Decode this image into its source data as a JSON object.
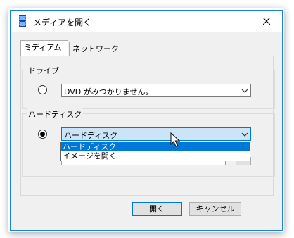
{
  "window": {
    "title": "メディアを開く"
  },
  "tabs": [
    {
      "label": "ミディアム",
      "active": true
    },
    {
      "label": "ネットワーク",
      "active": false
    }
  ],
  "drive_group": {
    "label": "ドライブ",
    "selected": false,
    "combo_value": "DVD がみつかりません。"
  },
  "harddisk_group": {
    "label": "ハードディスク",
    "selected": true,
    "combo_value": "ハードディスク",
    "dropdown_open": true,
    "options": [
      "ハードディスク",
      "イメージを開く"
    ],
    "highlighted_option": "ハードディスク"
  },
  "buttons": {
    "open": "開く",
    "cancel": "キャンセル"
  },
  "icons": {
    "app": "film-strip-icon",
    "close": "close-icon",
    "combo_arrow": "chevron-down-icon",
    "cursor": "mouse-pointer-icon"
  },
  "colors": {
    "accent": "#0078d7",
    "window_border": "#1883d7",
    "dialog_bg": "#f0f0f0",
    "open_combo_bg": "#cce4f7"
  }
}
